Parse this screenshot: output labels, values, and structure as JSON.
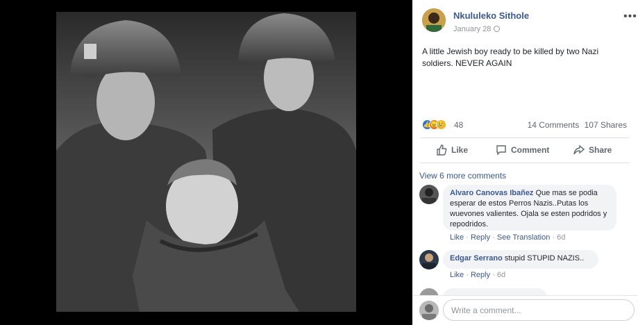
{
  "post": {
    "author": "Nkululeko Sithole",
    "date": "January 28",
    "text": "A little Jewish boy ready to be killed by two Nazi soldiers. NEVER AGAIN",
    "reaction_count": "48",
    "comments_count": "14 Comments",
    "shares_count": "107 Shares",
    "reaction_icons": [
      "like-reaction-icon",
      "angry-reaction-icon",
      "sad-reaction-icon"
    ]
  },
  "actions": {
    "like": "Like",
    "comment": "Comment",
    "share": "Share"
  },
  "comments": {
    "view_more": "View 6 more comments",
    "items": [
      {
        "author": "Alvaro Canovas Ibañez",
        "text": "Que mas se podia esperar de estos Perros Nazis..Putas los wuevones valientes. Ojala se esten podridos y repodridos.",
        "like": "Like",
        "reply": "Reply",
        "translation": "See Translation",
        "age": "6d"
      },
      {
        "author": "Edgar Serrano",
        "text": "stupid STUPID NAZIS..",
        "like": "Like",
        "reply": "Reply",
        "age": "6d"
      }
    ]
  },
  "composer": {
    "placeholder": "Write a comment..."
  },
  "colors": {
    "link": "#385898",
    "muted": "#90949c",
    "bubble": "#f2f3f5",
    "like_blue": "#1877f2"
  }
}
